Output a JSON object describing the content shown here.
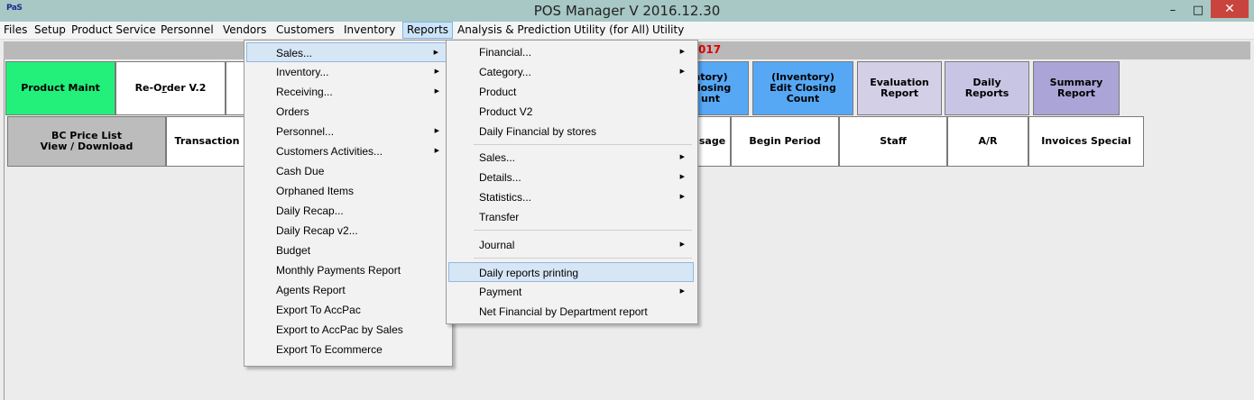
{
  "window": {
    "icon_text": "PaS",
    "title": "POS Manager V 2016.12.30",
    "minimize": "–",
    "maximize": "□",
    "close": "✕"
  },
  "menubar": [
    "Files",
    "Setup",
    "Product Service",
    "Personnel",
    "Vendors",
    "Customers",
    "Inventory",
    "Reports",
    "Analysis & Prediction",
    "Utility (for All)",
    "Utility"
  ],
  "info_fragment": "017",
  "row1": {
    "product_maint": "Product Maint",
    "reorder_pre": "Re-O",
    "reorder_u": "r",
    "reorder_post": "der V.2",
    "inv_closing_a": "ntory)",
    "inv_closing_b": "Closing",
    "inv_closing_c": "unt",
    "inv_edit_a": "(Inventory)",
    "inv_edit_b": "Edit Closing",
    "inv_edit_c": "Count",
    "eval_a": "Evaluation",
    "eval_b": "Report",
    "daily_a": "Daily",
    "daily_b": "Reports",
    "summary_a": "Summary",
    "summary_b": "Report"
  },
  "row2": {
    "bc_a": "BC Price List",
    "bc_b": "View / Download",
    "transaction": "Transaction",
    "usage": "sage",
    "begin_period": "Begin Period",
    "staff": "Staff",
    "ar": "A/R",
    "invoices_special": "Invoices Special"
  },
  "reports_menu": [
    "Sales...",
    "Inventory...",
    "Receiving...",
    "Orders",
    "Personnel...",
    "Customers Activities...",
    "Cash Due",
    "Orphaned Items",
    "Daily Recap...",
    "Daily Recap v2...",
    "Budget",
    "Monthly Payments Report",
    "Agents Report",
    "Export To AccPac",
    "Export to AccPac by Sales",
    "Export To Ecommerce"
  ],
  "sales_submenu": [
    "Financial...",
    "Category...",
    "Product",
    "Product V2",
    "Daily Financial by stores",
    "Sales...",
    "Details...",
    "Statistics...",
    "Transfer",
    "Journal",
    "Daily reports printing",
    "Payment",
    "Net Financial by Department report"
  ],
  "colors": {
    "title_bar": "#a7c8c4",
    "highlight": "#d7e6f5",
    "green_button": "#22f07b",
    "blue_button": "#56a8f5",
    "close_button": "#c9443d"
  }
}
